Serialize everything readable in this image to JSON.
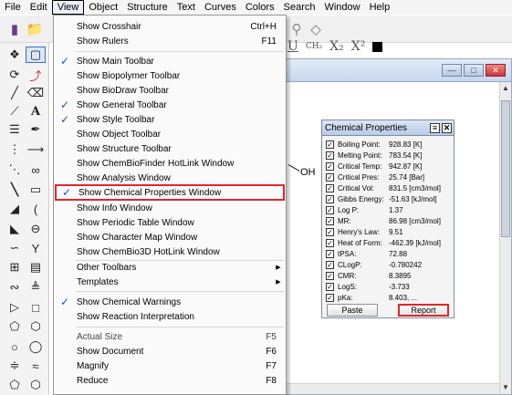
{
  "menubar": [
    "File",
    "Edit",
    "View",
    "Object",
    "Structure",
    "Text",
    "Curves",
    "Colors",
    "Search",
    "Window",
    "Help"
  ],
  "style_toolbar": {
    "underline": "U",
    "ch2": "CH₂",
    "sub": "X₂",
    "sup": "X²"
  },
  "view_menu": {
    "items": [
      {
        "label": "Show Crosshair",
        "shortcut": "Ctrl+H"
      },
      {
        "label": "Show Rulers",
        "shortcut": "F11"
      },
      {
        "label": "Show Main Toolbar",
        "checked": true
      },
      {
        "label": "Show Biopolymer Toolbar"
      },
      {
        "label": "Show BioDraw Toolbar"
      },
      {
        "label": "Show General Toolbar",
        "checked": true
      },
      {
        "label": "Show Style Toolbar",
        "checked": true
      },
      {
        "label": "Show Object Toolbar"
      },
      {
        "label": "Show Structure Toolbar"
      },
      {
        "label": "Show ChemBioFinder HotLink Window"
      },
      {
        "label": "Show Analysis Window"
      },
      {
        "label": "Show Chemical Properties Window",
        "checked": true
      },
      {
        "label": "Show Info Window"
      },
      {
        "label": "Show Periodic Table Window"
      },
      {
        "label": "Show Character Map Window"
      },
      {
        "label": "Show ChemBio3D HotLink Window"
      },
      {
        "label": "Other Toolbars",
        "submenu": true
      },
      {
        "label": "Templates",
        "submenu": true
      },
      {
        "label": "Show Chemical Warnings",
        "checked": true
      },
      {
        "label": "Show Reaction Interpretation"
      },
      {
        "label": "Actual Size",
        "shortcut": "F5",
        "disabled": true
      },
      {
        "label": "Show Document",
        "shortcut": "F6"
      },
      {
        "label": "Magnify",
        "shortcut": "F7"
      },
      {
        "label": "Reduce",
        "shortcut": "F8"
      }
    ]
  },
  "chem_props": {
    "title": "Chemical Properties",
    "rows": [
      {
        "name": "Boiling Point:",
        "value": "928.83 [K]"
      },
      {
        "name": "Melting Point:",
        "value": "783.54 [K]"
      },
      {
        "name": "Critical Temp:",
        "value": "942.87 [K]"
      },
      {
        "name": "Critical Pres:",
        "value": "25.74 [Bar]"
      },
      {
        "name": "Critical Vol:",
        "value": "831.5 [cm3/mol]"
      },
      {
        "name": "Gibbs Energy:",
        "value": "-51.63 [kJ/mol]"
      },
      {
        "name": "Log P:",
        "value": "1.37"
      },
      {
        "name": "MR:",
        "value": "86.98 [cm3/mol]"
      },
      {
        "name": "Henry's Law:",
        "value": "9.51"
      },
      {
        "name": "Heat of Form:",
        "value": "-462.39 [kJ/mol]"
      },
      {
        "name": "tPSA:",
        "value": "72.88"
      },
      {
        "name": "CLogP:",
        "value": "-0.780242"
      },
      {
        "name": "CMR:",
        "value": "8.3895"
      },
      {
        "name": "LogS:",
        "value": "-3.733"
      },
      {
        "name": "pKa:",
        "value": "8.403, ..."
      }
    ],
    "paste_label": "Paste",
    "report_label": "Report"
  },
  "canvas": {
    "atom_label": "OH"
  },
  "colors": {
    "highlight": "#e0262b",
    "check": "#1a55b0"
  }
}
